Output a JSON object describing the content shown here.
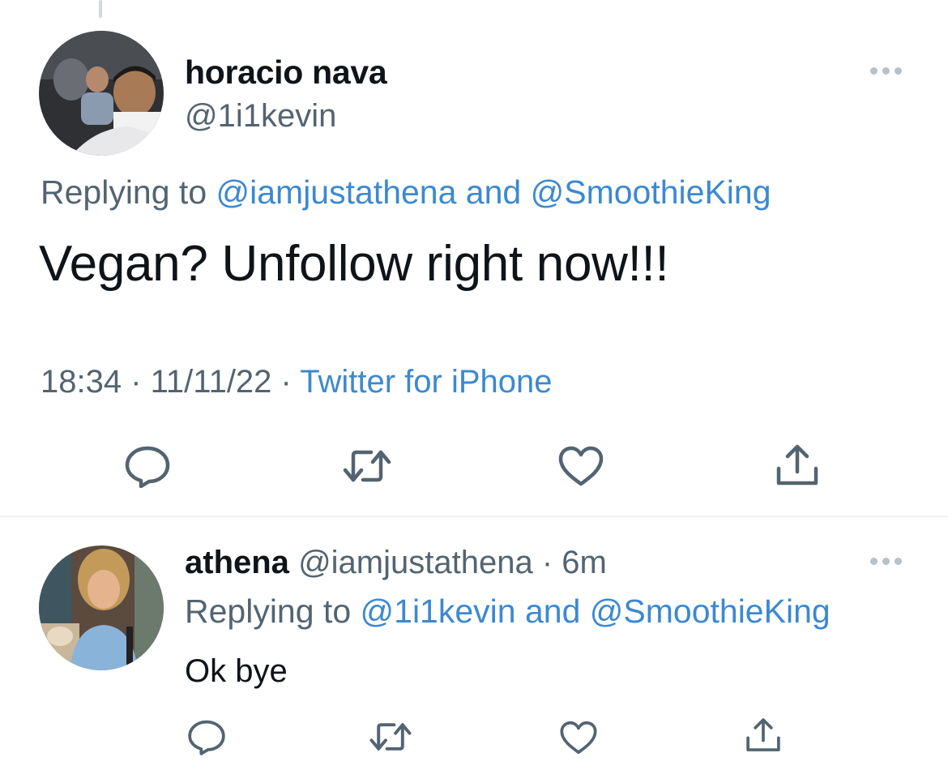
{
  "main_tweet": {
    "author_name": "horacio nava",
    "author_handle": "@1i1kevin",
    "replying_prefix": "Replying to ",
    "replying_to_1": "@iamjustathena",
    "replying_and": " and ",
    "replying_to_2": "@SmoothieKing",
    "text": "Vegan? Unfollow right now!!!",
    "time": "18:34",
    "sep": " · ",
    "date": "11/11/22",
    "source": "Twitter for iPhone"
  },
  "reply_tweet": {
    "author_name": "athena",
    "author_handle": "@iamjustathena",
    "sep": " · ",
    "age": "6m",
    "replying_prefix": "Replying to ",
    "replying_to_1": "@1i1kevin",
    "replying_and": " and ",
    "replying_to_2": "@SmoothieKing",
    "text": "Ok bye"
  },
  "icons": {
    "reply": "reply-icon",
    "retweet": "retweet-icon",
    "like": "heart-icon",
    "share": "share-icon",
    "more": "more-icon"
  },
  "colors": {
    "link": "#3c89d0",
    "secondary_text": "#536471",
    "icon": "#536471",
    "divider": "#eff3f4"
  }
}
